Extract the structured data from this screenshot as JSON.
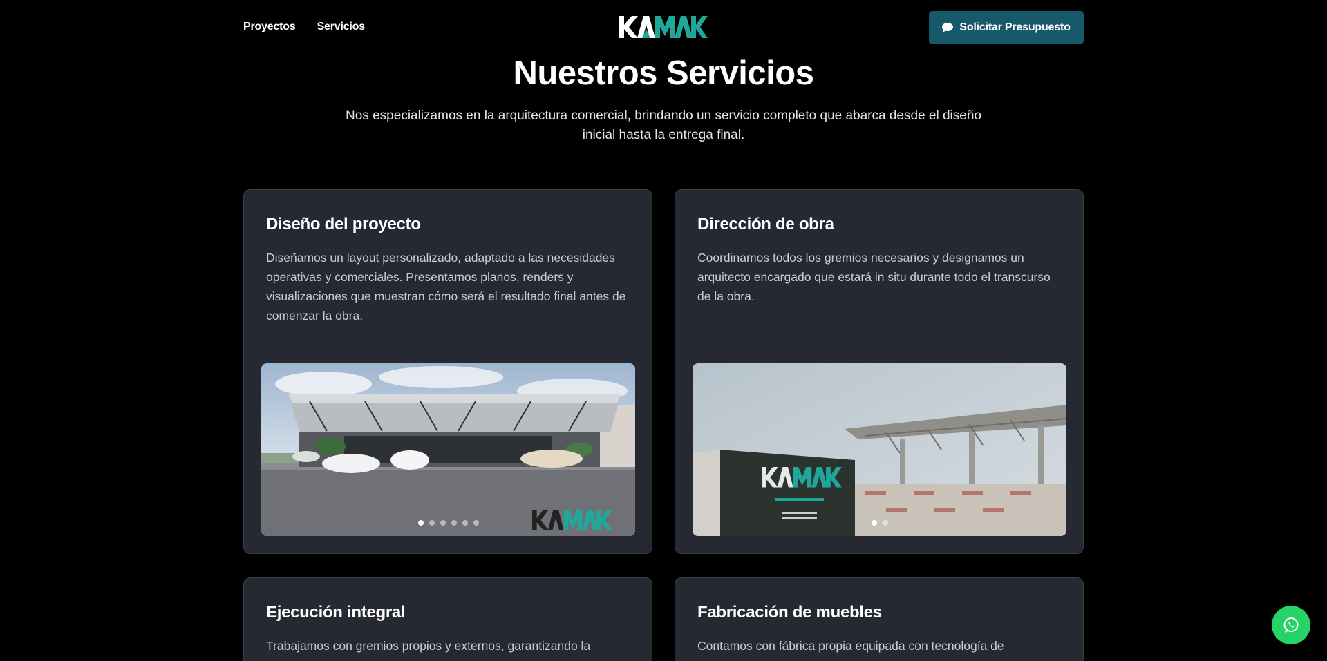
{
  "nav": {
    "links": [
      "Proyectos",
      "Servicios"
    ],
    "cta_label": "Solicitar Presupuesto",
    "cta_icon": "chat-bubble-icon",
    "logo_text": "KAMAK"
  },
  "hero": {
    "title": "Nuestros Servicios",
    "subtitle": "Nos especializamos en la arquitectura comercial, brindando un servicio completo que abarca desde el diseño inicial hasta la entrega final."
  },
  "services": [
    {
      "title": "Diseño del proyecto",
      "description": "Diseñamos un layout personalizado, adaptado a las necesidades operativas y comerciales. Presentamos planos, renders y visualizaciones que muestran cómo será el resultado final antes de comenzar la obra.",
      "slides": 6,
      "active_slide": 1
    },
    {
      "title": "Dirección de obra",
      "description": "Coordinamos todos los gremios necesarios y designamos un arquitecto encargado que estará in situ durante todo el transcurso de la obra.",
      "slides": 2,
      "active_slide": 1
    },
    {
      "title": "Ejecución integral",
      "description": "Trabajamos con gremios propios y externos, garantizando la"
    },
    {
      "title": "Fabricación de muebles",
      "description": "Contamos con fábrica propia equipada con tecnología de"
    }
  ],
  "colors": {
    "brand_teal": "#17596b",
    "logo_accent": "#1fa89a",
    "card_bg": "#262932",
    "whatsapp": "#25d366"
  },
  "floating": {
    "icon": "whatsapp-icon"
  }
}
